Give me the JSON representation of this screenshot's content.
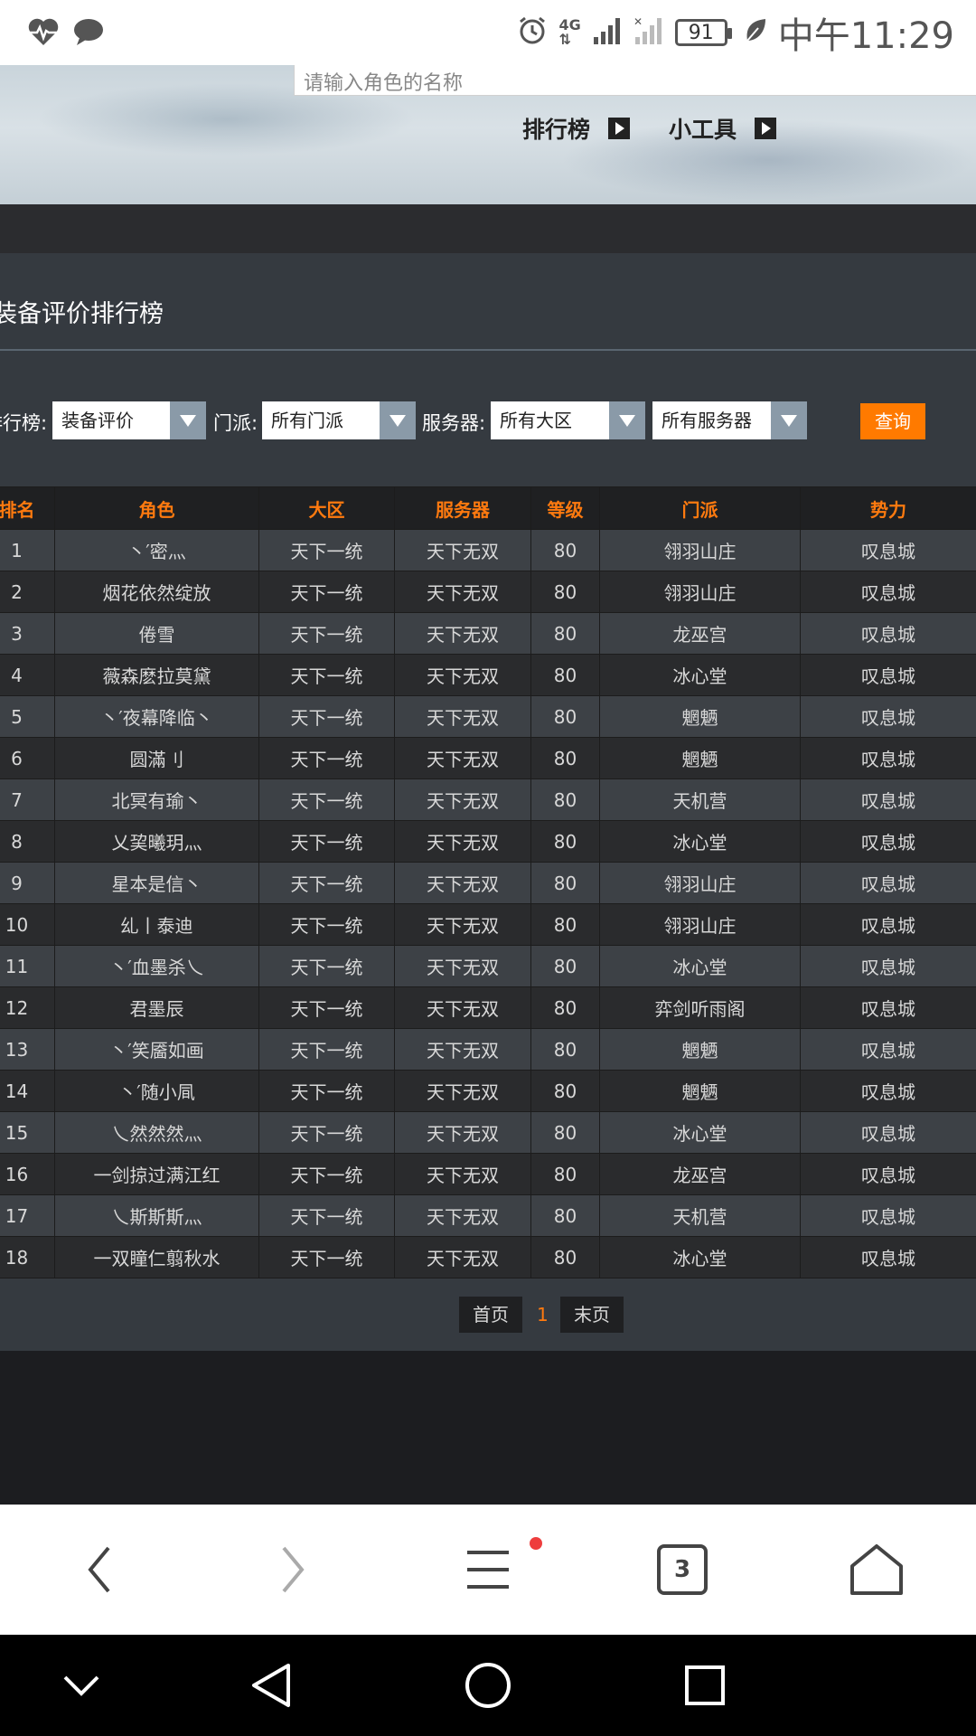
{
  "status_bar": {
    "network_label": "4G",
    "battery": "91",
    "time": "中午11:29",
    "icons": [
      "heartbeat-icon",
      "chat-bubble-icon",
      "alarm-icon",
      "signal-icon",
      "signal-off-icon",
      "battery-icon",
      "leaf-icon"
    ]
  },
  "banner": {
    "search_placeholder": "请输入角色的名称",
    "nav": [
      {
        "label": "排行榜"
      },
      {
        "label": "小工具"
      }
    ]
  },
  "panel": {
    "title": "装备评价排行榜"
  },
  "filters": {
    "ranking_label": "排行榜:",
    "ranking_value": "装备评价",
    "sect_label": "门派:",
    "sect_value": "所有门派",
    "server_label": "服务器:",
    "region_value": "所有大区",
    "server_value": "所有服务器",
    "query_button": "查询"
  },
  "table": {
    "headers": [
      "排名",
      "角色",
      "大区",
      "服务器",
      "等级",
      "门派",
      "势力"
    ],
    "rows": [
      [
        "1",
        "丶′密灬",
        "天下一统",
        "天下无双",
        "80",
        "翎羽山庄",
        "叹息城"
      ],
      [
        "2",
        "烟花依然绽放",
        "天下一统",
        "天下无双",
        "80",
        "翎羽山庄",
        "叹息城"
      ],
      [
        "3",
        "倦雪",
        "天下一统",
        "天下无双",
        "80",
        "龙巫宫",
        "叹息城"
      ],
      [
        "4",
        "薇森麽拉莫黛",
        "天下一统",
        "天下无双",
        "80",
        "冰心堂",
        "叹息城"
      ],
      [
        "5",
        "丶′夜幕降临丶",
        "天下一统",
        "天下无双",
        "80",
        "魍魉",
        "叹息城"
      ],
      [
        "6",
        "圆滿刂",
        "天下一统",
        "天下无双",
        "80",
        "魍魉",
        "叹息城"
      ],
      [
        "7",
        "北冥有瑜丶",
        "天下一统",
        "天下无双",
        "80",
        "天机营",
        "叹息城"
      ],
      [
        "8",
        "乂巭曦玥灬",
        "天下一统",
        "天下无双",
        "80",
        "冰心堂",
        "叹息城"
      ],
      [
        "9",
        "星本是信丶",
        "天下一统",
        "天下无双",
        "80",
        "翎羽山庄",
        "叹息城"
      ],
      [
        "10",
        "乣丨泰迪",
        "天下一统",
        "天下无双",
        "80",
        "翎羽山庄",
        "叹息城"
      ],
      [
        "11",
        "丶′血墨杀乀",
        "天下一统",
        "天下无双",
        "80",
        "冰心堂",
        "叹息城"
      ],
      [
        "12",
        "君墨辰",
        "天下一统",
        "天下无双",
        "80",
        "弈剑听雨阁",
        "叹息城"
      ],
      [
        "13",
        "丶′笑靥如画",
        "天下一统",
        "天下无双",
        "80",
        "魍魉",
        "叹息城"
      ],
      [
        "14",
        "丶′随小凬",
        "天下一统",
        "天下无双",
        "80",
        "魍魉",
        "叹息城"
      ],
      [
        "15",
        "乀然然然灬",
        "天下一统",
        "天下无双",
        "80",
        "冰心堂",
        "叹息城"
      ],
      [
        "16",
        "一剑掠过满江红",
        "天下一统",
        "天下无双",
        "80",
        "龙巫宫",
        "叹息城"
      ],
      [
        "17",
        "乀斯斯斯灬",
        "天下一统",
        "天下无双",
        "80",
        "天机营",
        "叹息城"
      ],
      [
        "18",
        "一双瞳仁翦秋水",
        "天下一统",
        "天下无双",
        "80",
        "冰心堂",
        "叹息城"
      ]
    ]
  },
  "pager": {
    "first": "首页",
    "current": "1",
    "last": "末页"
  },
  "browser_bar": {
    "tabs_count": "3",
    "icons": [
      "back-icon",
      "forward-icon",
      "menu-icon",
      "tabs-icon",
      "home-icon"
    ]
  },
  "system_nav": {
    "icons": [
      "collapse-icon",
      "nav-back-icon",
      "nav-home-icon",
      "nav-recents-icon"
    ]
  }
}
